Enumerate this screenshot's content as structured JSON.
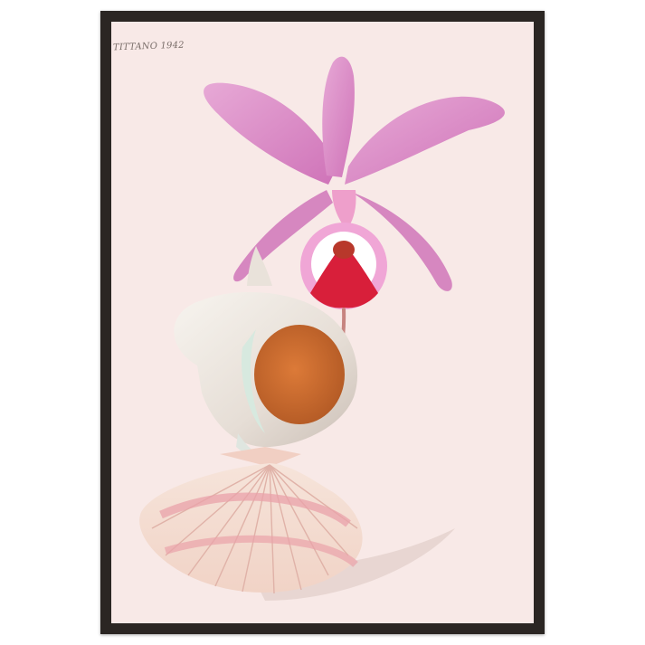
{
  "artwork": {
    "signature": "TITTANO 1942",
    "colors": {
      "frame": "#2b2623",
      "background": "#f8e9e7",
      "orchid_petal": "#d98cc4",
      "orchid_lip": "#d81f3a",
      "conch_shell": "#ece6e0",
      "conch_interior": "#c66a2e",
      "scallop_shell": "#f4dcd2",
      "scallop_stripes": "#e9a2a9"
    }
  }
}
